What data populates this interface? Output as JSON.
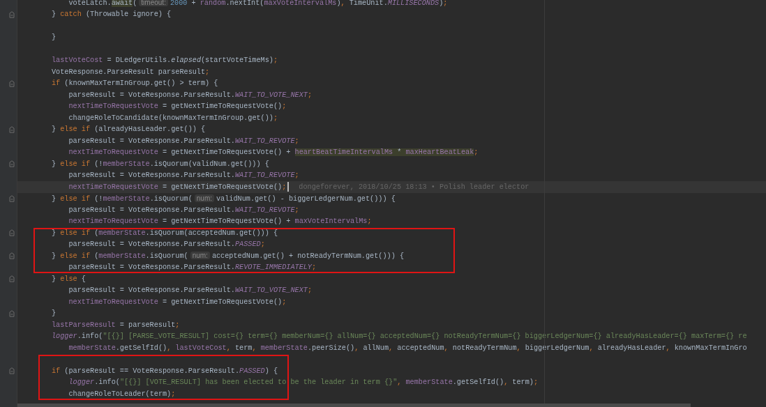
{
  "editor": {
    "blocks": [
      {
        "boxed": false,
        "lines": [
          {
            "fold": false,
            "current": false,
            "kind": "inner",
            "tokens": [
              {
                "kind": "plain",
                "text": "voteLatch."
              },
              {
                "kind": "usage_plain",
                "text": "await"
              },
              {
                "kind": "plain",
                "text": "("
              },
              {
                "kind": "hint",
                "text": "timeout:"
              },
              {
                "kind": "number",
                "text": "2000"
              },
              {
                "kind": "plain",
                "text": " + "
              },
              {
                "kind": "field",
                "text": "random"
              },
              {
                "kind": "plain",
                "text": ".nextInt("
              },
              {
                "kind": "field",
                "text": "maxVoteIntervalMs"
              },
              {
                "kind": "plain",
                "text": ")"
              },
              {
                "kind": "punct",
                "text": ", "
              },
              {
                "kind": "plain",
                "text": "TimeUnit."
              },
              {
                "kind": "constant",
                "text": "MILLISECONDS"
              },
              {
                "kind": "plain",
                "text": ")"
              },
              {
                "kind": "punct",
                "text": ";"
              }
            ]
          },
          {
            "fold": true,
            "current": false,
            "kind": "outer",
            "tokens": [
              {
                "kind": "plain",
                "text": "} "
              },
              {
                "kind": "keyword",
                "text": "catch"
              },
              {
                "kind": "plain",
                "text": " (Throwable ignore) {"
              }
            ]
          },
          {
            "fold": false,
            "current": false
          },
          {
            "fold": false,
            "current": false,
            "kind": "outer",
            "tokens": [
              {
                "kind": "plain",
                "text": "}"
              }
            ]
          },
          {
            "fold": false,
            "current": false
          },
          {
            "fold": false,
            "current": false,
            "kind": "outer",
            "tokens": [
              {
                "kind": "field",
                "text": "lastVoteCost"
              },
              {
                "kind": "plain",
                "text": " = DLedgerUtils."
              },
              {
                "kind": "static_method",
                "text": "elapsed"
              },
              {
                "kind": "plain",
                "text": "(startVoteTimeMs)"
              },
              {
                "kind": "punct",
                "text": ";"
              }
            ]
          },
          {
            "fold": false,
            "current": false,
            "kind": "outer",
            "tokens": [
              {
                "kind": "plain",
                "text": "VoteResponse.ParseResult parseResult"
              },
              {
                "kind": "punct",
                "text": ";"
              }
            ]
          },
          {
            "fold": true,
            "current": false,
            "kind": "outer",
            "tokens": [
              {
                "kind": "keyword",
                "text": "if"
              },
              {
                "kind": "plain",
                "text": " (knownMaxTermInGroup.get() > term) {"
              }
            ]
          },
          {
            "fold": false,
            "current": false,
            "kind": "inner",
            "tokens": [
              {
                "kind": "plain",
                "text": "parseResult = VoteResponse.ParseResult."
              },
              {
                "kind": "constant",
                "text": "WAIT_TO_VOTE_NEXT"
              },
              {
                "kind": "punct",
                "text": ";"
              }
            ]
          },
          {
            "fold": false,
            "current": false,
            "kind": "inner",
            "tokens": [
              {
                "kind": "field",
                "text": "nextTimeToRequestVote"
              },
              {
                "kind": "plain",
                "text": " = getNextTimeToRequestVote()"
              },
              {
                "kind": "punct",
                "text": ";"
              }
            ]
          },
          {
            "fold": false,
            "current": false,
            "kind": "inner",
            "tokens": [
              {
                "kind": "plain",
                "text": "changeRoleToCandidate(knownMaxTermInGroup.get())"
              },
              {
                "kind": "punct",
                "text": ";"
              }
            ]
          },
          {
            "fold": true,
            "current": false,
            "kind": "outer",
            "tokens": [
              {
                "kind": "plain",
                "text": "} "
              },
              {
                "kind": "keyword",
                "text": "else if"
              },
              {
                "kind": "plain",
                "text": " (alreadyHasLeader.get()) {"
              }
            ]
          },
          {
            "fold": false,
            "current": false,
            "kind": "inner",
            "tokens": [
              {
                "kind": "plain",
                "text": "parseResult = VoteResponse.ParseResult."
              },
              {
                "kind": "constant",
                "text": "WAIT_TO_REVOTE"
              },
              {
                "kind": "punct",
                "text": ";"
              }
            ]
          },
          {
            "fold": false,
            "current": false,
            "kind": "inner",
            "tokens": [
              {
                "kind": "field",
                "text": "nextTimeToRequestVote"
              },
              {
                "kind": "plain",
                "text": " = getNextTimeToRequestVote() + "
              },
              {
                "kind": "usage_field",
                "text": "heartBeatTimeIntervalMs"
              },
              {
                "kind": "usage_plain",
                "text": " * "
              },
              {
                "kind": "usage_field",
                "text": "maxHeartBeatLeak"
              },
              {
                "kind": "punct",
                "text": ";"
              }
            ]
          },
          {
            "fold": true,
            "current": false,
            "kind": "outer",
            "tokens": [
              {
                "kind": "plain",
                "text": "} "
              },
              {
                "kind": "keyword",
                "text": "else if"
              },
              {
                "kind": "plain",
                "text": " (!"
              },
              {
                "kind": "field",
                "text": "memberState"
              },
              {
                "kind": "plain",
                "text": ".isQuorum(validNum.get())) {"
              }
            ]
          },
          {
            "fold": false,
            "current": false,
            "kind": "inner",
            "tokens": [
              {
                "kind": "plain",
                "text": "parseResult = VoteResponse.ParseResult."
              },
              {
                "kind": "constant",
                "text": "WAIT_TO_REVOTE"
              },
              {
                "kind": "punct",
                "text": ";"
              }
            ]
          },
          {
            "fold": false,
            "current": true,
            "kind": "inner",
            "blame": "dongeforever, 2018/10/25 18:13 • Polish leader elector",
            "tokens": [
              {
                "kind": "field",
                "text": "nextTimeToRequestVote"
              },
              {
                "kind": "plain",
                "text": " = getNextTimeToRequestVote()"
              },
              {
                "kind": "punct",
                "text": ";"
              }
            ]
          },
          {
            "fold": true,
            "current": false,
            "kind": "outer",
            "tokens": [
              {
                "kind": "plain",
                "text": "} "
              },
              {
                "kind": "keyword",
                "text": "else if"
              },
              {
                "kind": "plain",
                "text": " (!"
              },
              {
                "kind": "field",
                "text": "memberState"
              },
              {
                "kind": "plain",
                "text": ".isQuorum("
              },
              {
                "kind": "hint",
                "text": "num:"
              },
              {
                "kind": "plain",
                "text": "validNum.get() - biggerLedgerNum.get())) {"
              }
            ]
          },
          {
            "fold": false,
            "current": false,
            "kind": "inner",
            "tokens": [
              {
                "kind": "plain",
                "text": "parseResult = VoteResponse.ParseResult."
              },
              {
                "kind": "constant",
                "text": "WAIT_TO_REVOTE"
              },
              {
                "kind": "punct",
                "text": ";"
              }
            ]
          },
          {
            "fold": false,
            "current": false,
            "kind": "inner",
            "tokens": [
              {
                "kind": "field",
                "text": "nextTimeToRequestVote"
              },
              {
                "kind": "plain",
                "text": " = getNextTimeToRequestVote() + "
              },
              {
                "kind": "field",
                "text": "maxVoteIntervalMs"
              },
              {
                "kind": "punct",
                "text": ";"
              }
            ]
          }
        ]
      },
      {
        "boxed": true,
        "lines": [
          {
            "fold": true,
            "current": false,
            "kind": "outer",
            "tokens": [
              {
                "kind": "plain",
                "text": "} "
              },
              {
                "kind": "keyword",
                "text": "else if"
              },
              {
                "kind": "plain",
                "text": " ("
              },
              {
                "kind": "field",
                "text": "memberState"
              },
              {
                "kind": "plain",
                "text": ".isQuorum(acceptedNum.get())) {"
              }
            ]
          },
          {
            "fold": false,
            "current": false,
            "kind": "inner",
            "tokens": [
              {
                "kind": "plain",
                "text": "parseResult = VoteResponse.ParseResult."
              },
              {
                "kind": "constant",
                "text": "PASSED"
              },
              {
                "kind": "punct",
                "text": ";"
              }
            ]
          },
          {
            "fold": true,
            "current": false,
            "kind": "outer",
            "tokens": [
              {
                "kind": "plain",
                "text": "} "
              },
              {
                "kind": "keyword",
                "text": "else if"
              },
              {
                "kind": "plain",
                "text": " ("
              },
              {
                "kind": "field",
                "text": "memberState"
              },
              {
                "kind": "plain",
                "text": ".isQuorum("
              },
              {
                "kind": "hint",
                "text": "num:"
              },
              {
                "kind": "plain",
                "text": "acceptedNum.get() + notReadyTermNum.get())) {"
              }
            ]
          },
          {
            "fold": false,
            "current": false,
            "kind": "inner",
            "tokens": [
              {
                "kind": "plain",
                "text": "parseResult = VoteResponse.ParseResult."
              },
              {
                "kind": "constant",
                "text": "REVOTE_IMMEDIATELY"
              },
              {
                "kind": "punct",
                "text": ";"
              }
            ]
          }
        ]
      },
      {
        "boxed": false,
        "lines": [
          {
            "fold": true,
            "current": false,
            "kind": "outer",
            "tokens": [
              {
                "kind": "plain",
                "text": "} "
              },
              {
                "kind": "keyword",
                "text": "else"
              },
              {
                "kind": "plain",
                "text": " {"
              }
            ]
          },
          {
            "fold": false,
            "current": false,
            "kind": "inner",
            "tokens": [
              {
                "kind": "plain",
                "text": "parseResult = VoteResponse.ParseResult."
              },
              {
                "kind": "constant",
                "text": "WAIT_TO_VOTE_NEXT"
              },
              {
                "kind": "punct",
                "text": ";"
              }
            ]
          },
          {
            "fold": false,
            "current": false,
            "kind": "inner",
            "tokens": [
              {
                "kind": "field",
                "text": "nextTimeToRequestVote"
              },
              {
                "kind": "plain",
                "text": " = getNextTimeToRequestVote()"
              },
              {
                "kind": "punct",
                "text": ";"
              }
            ]
          },
          {
            "fold": true,
            "current": false,
            "kind": "outer",
            "tokens": [
              {
                "kind": "plain",
                "text": "}"
              }
            ]
          },
          {
            "fold": false,
            "current": false,
            "kind": "outer",
            "tokens": [
              {
                "kind": "field",
                "text": "lastParseResult"
              },
              {
                "kind": "plain",
                "text": " = parseResult"
              },
              {
                "kind": "punct",
                "text": ";"
              }
            ]
          },
          {
            "fold": false,
            "current": false,
            "kind": "outer",
            "tokens": [
              {
                "kind": "static_field",
                "text": "logger"
              },
              {
                "kind": "plain",
                "text": ".info("
              },
              {
                "kind": "string",
                "text": "\"[{}] [PARSE_VOTE_RESULT] cost={} term={} memberNum={} allNum={} acceptedNum={} notReadyTermNum={} biggerLedgerNum={} alreadyHasLeader={} maxTerm={} re"
              }
            ]
          },
          {
            "fold": false,
            "current": false,
            "kind": "inner",
            "tokens": [
              {
                "kind": "field",
                "text": "memberState"
              },
              {
                "kind": "plain",
                "text": ".getSelfId()"
              },
              {
                "kind": "punct",
                "text": ", "
              },
              {
                "kind": "field",
                "text": "lastVoteCost"
              },
              {
                "kind": "punct",
                "text": ", "
              },
              {
                "kind": "plain",
                "text": "term"
              },
              {
                "kind": "punct",
                "text": ", "
              },
              {
                "kind": "field",
                "text": "memberState"
              },
              {
                "kind": "plain",
                "text": ".peerSize()"
              },
              {
                "kind": "punct",
                "text": ", "
              },
              {
                "kind": "plain",
                "text": "allNum"
              },
              {
                "kind": "punct",
                "text": ", "
              },
              {
                "kind": "plain",
                "text": "acceptedNum"
              },
              {
                "kind": "punct",
                "text": ", "
              },
              {
                "kind": "plain",
                "text": "notReadyTermNum"
              },
              {
                "kind": "punct",
                "text": ", "
              },
              {
                "kind": "plain",
                "text": "biggerLedgerNum"
              },
              {
                "kind": "punct",
                "text": ", "
              },
              {
                "kind": "plain",
                "text": "alreadyHasLeader"
              },
              {
                "kind": "punct",
                "text": ", "
              },
              {
                "kind": "plain",
                "text": "knownMaxTermInGro"
              }
            ]
          }
        ]
      },
      {
        "boxed": true,
        "lines": [
          {
            "fold": false,
            "current": false
          },
          {
            "fold": true,
            "current": false,
            "kind": "outer",
            "tokens": [
              {
                "kind": "keyword",
                "text": "if"
              },
              {
                "kind": "plain",
                "text": " (parseResult == VoteResponse.ParseResult."
              },
              {
                "kind": "constant",
                "text": "PASSED"
              },
              {
                "kind": "plain",
                "text": ") {"
              }
            ]
          },
          {
            "fold": false,
            "current": false,
            "kind": "inner",
            "tokens": [
              {
                "kind": "static_field",
                "text": "logger"
              },
              {
                "kind": "plain",
                "text": ".info("
              },
              {
                "kind": "string",
                "text": "\"[{}] [VOTE_RESULT] has been elected to be the leader in term {}\""
              },
              {
                "kind": "punct",
                "text": ", "
              },
              {
                "kind": "field",
                "text": "memberState"
              },
              {
                "kind": "plain",
                "text": ".getSelfId()"
              },
              {
                "kind": "punct",
                "text": ", "
              },
              {
                "kind": "plain",
                "text": "term)"
              },
              {
                "kind": "punct",
                "text": ";"
              }
            ]
          },
          {
            "fold": false,
            "current": false,
            "kind": "inner",
            "tokens": [
              {
                "kind": "plain",
                "text": "changeRoleToLeader(term)"
              },
              {
                "kind": "punct",
                "text": ";"
              }
            ]
          }
        ]
      }
    ]
  }
}
